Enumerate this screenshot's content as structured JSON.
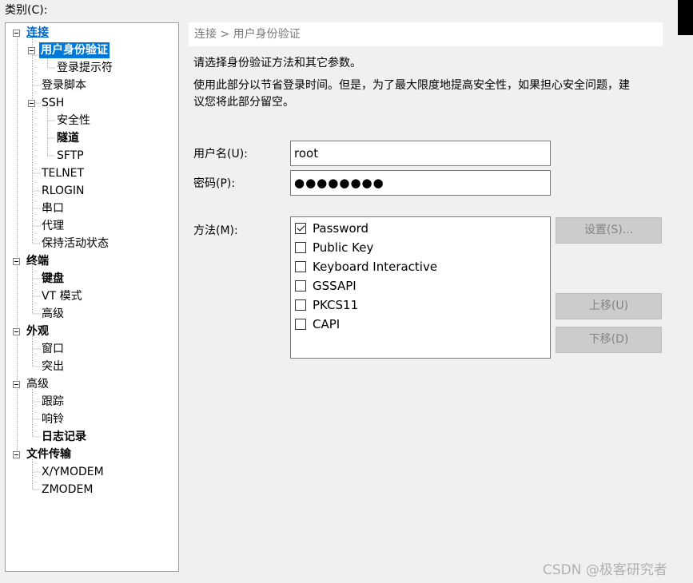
{
  "category_label": "类别(C):",
  "tree": {
    "connection": "连接",
    "auth": "用户身份验证",
    "login_prompt": "登录提示符",
    "login_script": "登录脚本",
    "ssh": "SSH",
    "security": "安全性",
    "tunnel": "隧道",
    "sftp": "SFTP",
    "telnet": "TELNET",
    "rlogin": "RLOGIN",
    "serial": "串口",
    "proxy": "代理",
    "keepalive": "保持活动状态",
    "terminal": "终端",
    "keyboard": "键盘",
    "vt_mode": "VT 模式",
    "terminal_advanced": "高级",
    "appearance": "外观",
    "window": "窗口",
    "highlight": "突出",
    "advanced": "高级",
    "trace": "跟踪",
    "bell": "响铃",
    "logging": "日志记录",
    "file_transfer": "文件传输",
    "xymodem": "X/YMODEM",
    "zmodem": "ZMODEM"
  },
  "header": {
    "breadcrumb": "连接 > 用户身份验证"
  },
  "description": {
    "line1": "请选择身份验证方法和其它参数。",
    "line2": "使用此部分以节省登录时间。但是，为了最大限度地提高安全性，如果担心安全问题，建",
    "line3": "议您将此部分留空。"
  },
  "form": {
    "username_label": "用户名(U):",
    "username_value": "root",
    "password_label": "密码(P):",
    "password_value": "●●●●●●●●",
    "method_label": "方法(M):"
  },
  "methods": [
    {
      "label": "Password",
      "checked": true
    },
    {
      "label": "Public Key",
      "checked": false
    },
    {
      "label": "Keyboard Interactive",
      "checked": false
    },
    {
      "label": "GSSAPI",
      "checked": false
    },
    {
      "label": "PKCS11",
      "checked": false
    },
    {
      "label": "CAPI",
      "checked": false
    }
  ],
  "buttons": {
    "settings": "设置(S)...",
    "move_up": "上移(U)",
    "move_down": "下移(D)"
  },
  "watermark": "CSDN @极客研究者"
}
